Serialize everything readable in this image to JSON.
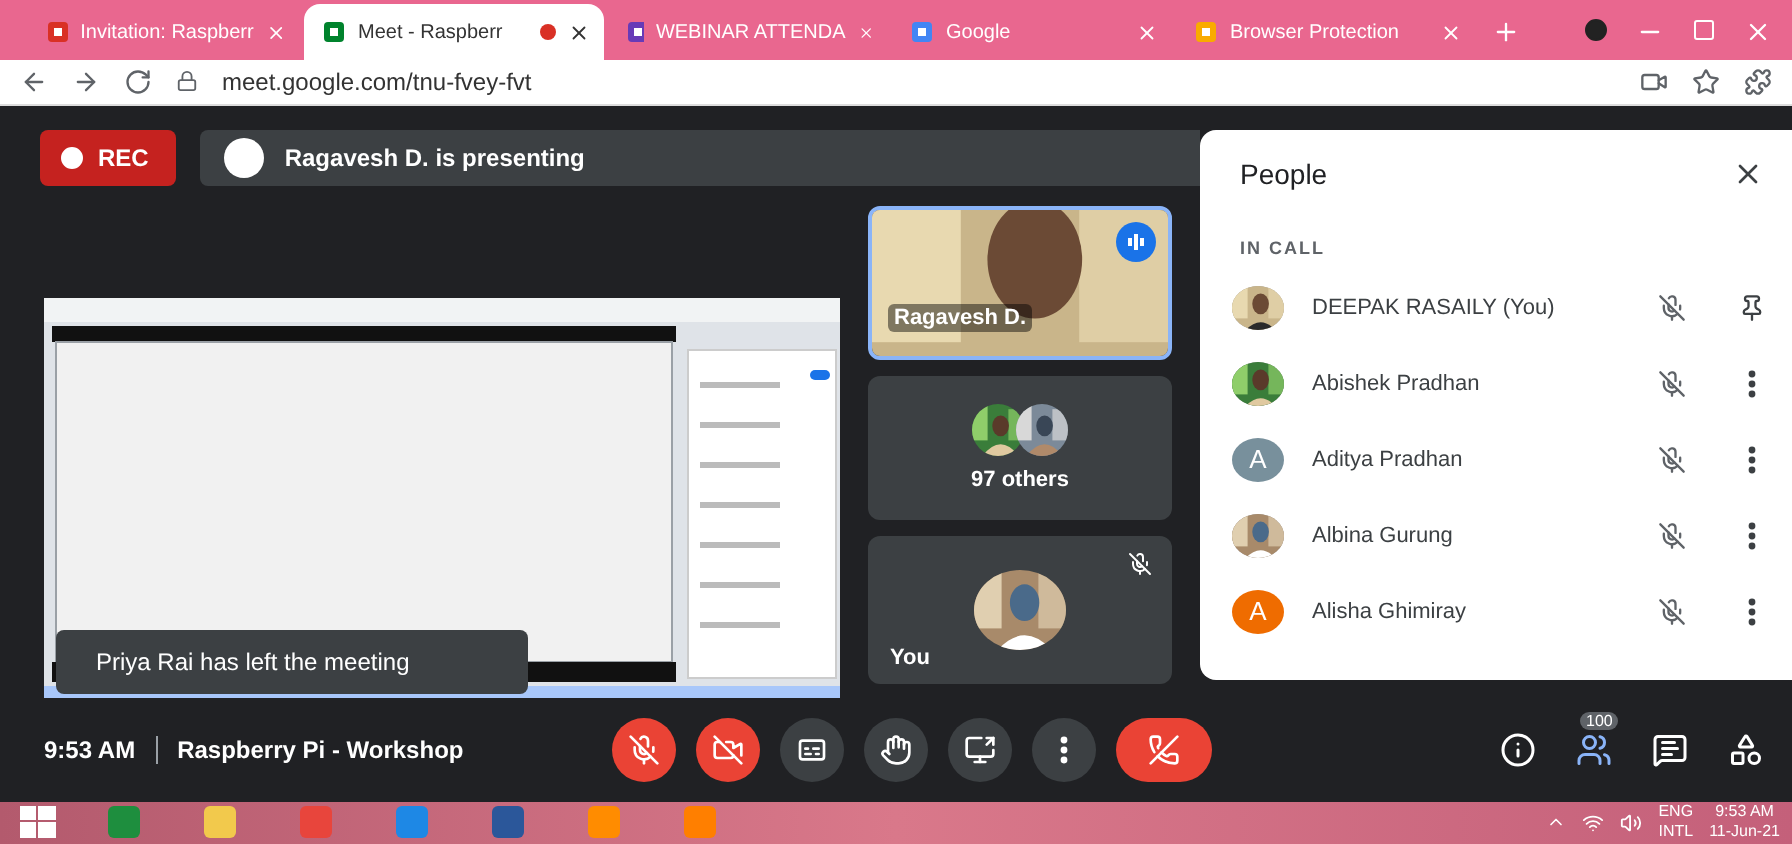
{
  "browser": {
    "tabs": [
      {
        "title": "Invitation: Raspberr",
        "selected": false,
        "recording": false,
        "kind": "mail"
      },
      {
        "title": "Meet - Raspberr",
        "selected": true,
        "recording": true,
        "kind": "meet"
      },
      {
        "title": "WEBINAR ATTENDA",
        "selected": false,
        "recording": false,
        "kind": "form"
      },
      {
        "title": "Google",
        "selected": false,
        "recording": false,
        "kind": "google"
      },
      {
        "title": "Browser Protection",
        "selected": false,
        "recording": false,
        "kind": "shield"
      }
    ],
    "url": "meet.google.com/tnu-fvey-fvt"
  },
  "meeting": {
    "rec_label": "REC",
    "presenting": "Ragavesh D. is presenting",
    "tiles": [
      {
        "kind": "speaker",
        "name": "Ragavesh D.",
        "speaking": true
      },
      {
        "kind": "others",
        "name": "97 others"
      },
      {
        "kind": "self",
        "name": "You",
        "muted": true
      }
    ],
    "toast": "Priya Rai has left the meeting",
    "time": "9:53 AM",
    "title": "Raspberry Pi - Workshop",
    "controls": [
      {
        "kind": "mic",
        "off": true
      },
      {
        "kind": "camera",
        "off": true
      },
      {
        "kind": "captions",
        "off": false
      },
      {
        "kind": "hand",
        "off": false
      },
      {
        "kind": "present",
        "off": false
      },
      {
        "kind": "more",
        "off": false
      },
      {
        "kind": "hangup"
      }
    ],
    "people_count": "100"
  },
  "people": {
    "title": "People",
    "section": "IN CALL",
    "participants": [
      {
        "kind": "self",
        "name": "DEEPAK RASAILY (You)",
        "muted": true
      },
      {
        "kind": "guest",
        "name": "Abishek Pradhan",
        "muted": true
      },
      {
        "kind": "guest",
        "name": "Aditya Pradhan",
        "avatar": {
          "kind": "letter",
          "letter": "A",
          "color": "#78909c"
        },
        "muted": true
      },
      {
        "kind": "guest",
        "name": "Albina Gurung",
        "muted": true
      },
      {
        "kind": "guest",
        "name": "Alisha Ghimiray",
        "avatar": {
          "kind": "letter",
          "letter": "A",
          "color": "#ef6c00"
        },
        "muted": true
      }
    ]
  },
  "taskbar": {
    "language": "ENG",
    "layout": "INTL",
    "time": "9:53 AM",
    "date": "11-Jun-21"
  }
}
